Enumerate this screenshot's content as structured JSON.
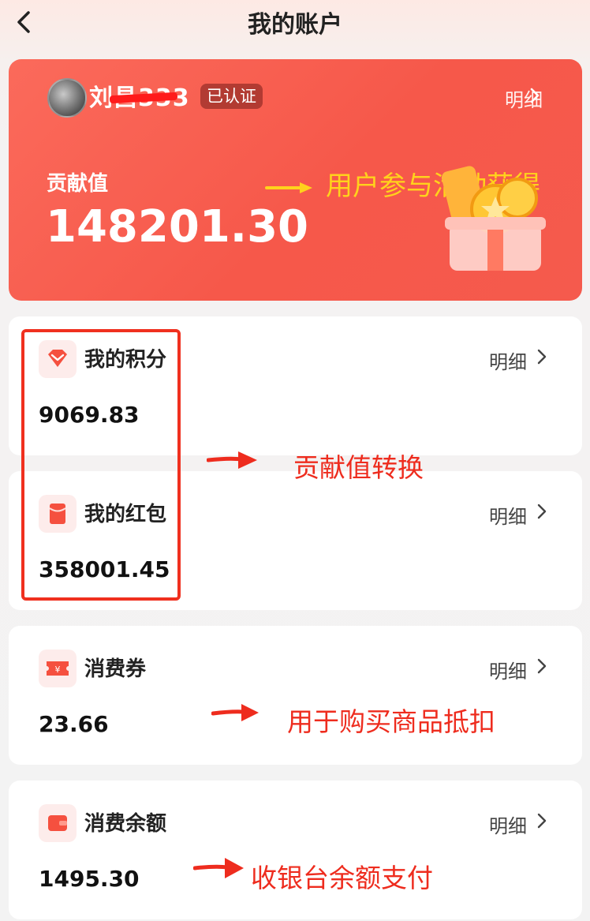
{
  "header": {
    "title": "我的账户",
    "back_icon": "chevron-left-icon"
  },
  "hero": {
    "user_name": "刘昌333",
    "verified_badge": "已认证",
    "detail_label": "明细",
    "label": "贡献值",
    "value": "148201.30",
    "annotation": "用户参与活动获得",
    "accent_color": "#f65b4c"
  },
  "cards": [
    {
      "icon": "gem-icon",
      "title": "我的积分",
      "detail_label": "明细",
      "value": "9069.83"
    },
    {
      "icon": "red-envelope-icon",
      "title": "我的红包",
      "detail_label": "明细",
      "value": "358001.45"
    },
    {
      "icon": "yuan-coupon-icon",
      "title": "消费券",
      "detail_label": "明细",
      "value": "23.66"
    },
    {
      "icon": "wallet-icon",
      "title": "消费余额",
      "detail_label": "明细",
      "value": "1495.30"
    }
  ],
  "annotations": {
    "conversion": "贡献值转换",
    "coupon_usage": "用于购买商品抵扣",
    "balance_usage": "收银台余额支付"
  }
}
